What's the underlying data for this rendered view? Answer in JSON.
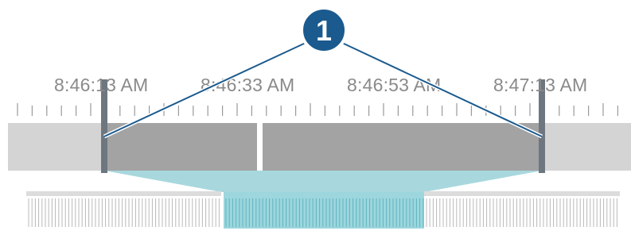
{
  "timeline": {
    "labels": [
      "8:46:13 AM",
      "8:46:33 AM",
      "8:46:53 AM",
      "8:47:13 AM"
    ]
  },
  "callout": {
    "number": "1"
  },
  "colors": {
    "track_outer": "#d4d4d4",
    "track_selected": "#a3a3a3",
    "playhead": "#ffffff",
    "handle": "#6e7780",
    "zoom_fill": "#a8d8de",
    "zoom_band": "#8ccfd7",
    "zoom_ticks": "#5fb4bf",
    "ticks": "#9a9a9a",
    "callout_fill": "#1a5a8e",
    "callout_line": "#1a5a8e"
  },
  "icons": {
    "callout": "numbered-circle-icon",
    "handle": "trim-handle-icon"
  }
}
